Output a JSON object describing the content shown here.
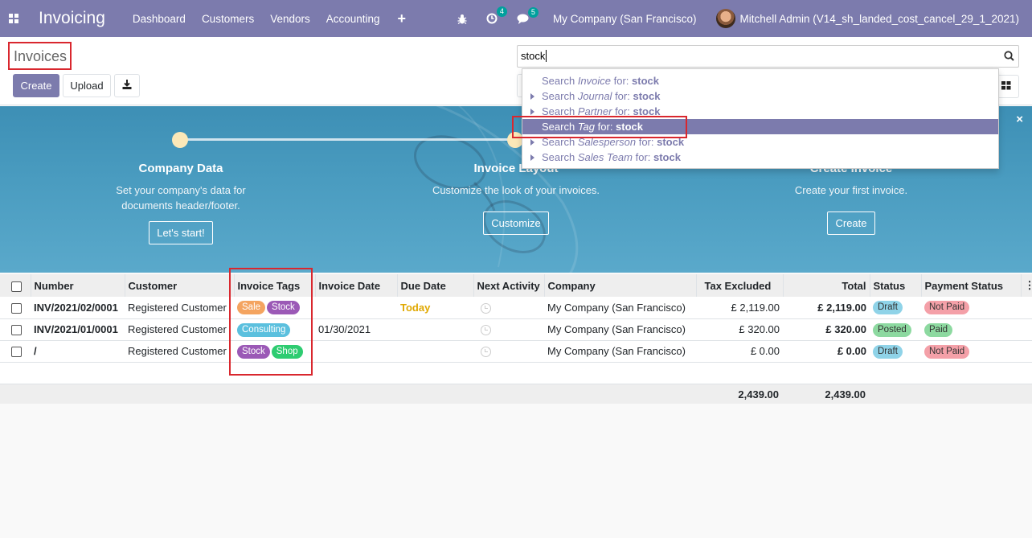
{
  "navbar": {
    "app_name": "Invoicing",
    "menu": [
      "Dashboard",
      "Customers",
      "Vendors",
      "Accounting"
    ],
    "plus": "+",
    "activity_count": "4",
    "message_count": "5",
    "company": "My Company (San Francisco)",
    "user": "Mitchell Admin (V14_sh_landed_cost_cancel_29_1_2021)"
  },
  "control_panel": {
    "title": "Invoices",
    "create_label": "Create",
    "upload_label": "Upload",
    "search_value": "stock"
  },
  "autocomplete": [
    {
      "pre": "Search ",
      "field": "Invoice",
      "mid": " for: ",
      "term": "stock",
      "expandable": false,
      "active": false
    },
    {
      "pre": "Search ",
      "field": "Journal",
      "mid": " for: ",
      "term": "stock",
      "expandable": true,
      "active": false
    },
    {
      "pre": "Search ",
      "field": "Partner",
      "mid": " for: ",
      "term": "stock",
      "expandable": true,
      "active": false
    },
    {
      "pre": "Search ",
      "field": "Tag",
      "mid": " for: ",
      "term": "stock",
      "expandable": false,
      "active": true
    },
    {
      "pre": "Search ",
      "field": "Salesperson",
      "mid": " for: ",
      "term": "stock",
      "expandable": true,
      "active": false
    },
    {
      "pre": "Search ",
      "field": "Sales Team",
      "mid": " for: ",
      "term": "stock",
      "expandable": true,
      "active": false
    }
  ],
  "banner": {
    "close": "×",
    "steps": [
      {
        "title": "Company Data",
        "desc1": "Set your company's data for",
        "desc2": "documents header/footer.",
        "button": "Let's start!"
      },
      {
        "title": "Invoice Layout",
        "desc1": "Customize the look of your invoices.",
        "desc2": "",
        "button": "Customize"
      },
      {
        "title": "Create Invoice",
        "desc1": "Create your first invoice.",
        "desc2": "",
        "button": "Create"
      }
    ]
  },
  "table": {
    "headers": [
      "Number",
      "Customer",
      "Invoice Tags",
      "Invoice Date",
      "Due Date",
      "Next Activity",
      "Company",
      "Tax Excluded",
      "Total",
      "Status",
      "Payment Status"
    ],
    "rows": [
      {
        "number": "INV/2021/02/0001",
        "customer": "Registered Customer",
        "tags": [
          {
            "label": "Sale",
            "color": "#f4a460"
          },
          {
            "label": "Stock",
            "color": "#9b59b6"
          }
        ],
        "invoice_date": "",
        "due_date": "Today",
        "company": "My Company (San Francisco)",
        "tax_excluded": "£ 2,119.00",
        "total": "£ 2,119.00",
        "status": "Draft",
        "status_color": "#8fd3e8",
        "payment": "Not Paid",
        "payment_color": "#f4a0a8"
      },
      {
        "number": "INV/2021/01/0001",
        "customer": "Registered Customer",
        "tags": [
          {
            "label": "Consulting",
            "color": "#5bc0de"
          }
        ],
        "invoice_date": "01/30/2021",
        "due_date": "",
        "company": "My Company (San Francisco)",
        "tax_excluded": "£ 320.00",
        "total": "£ 320.00",
        "status": "Posted",
        "status_color": "#8dd9a0",
        "payment": "Paid",
        "payment_color": "#8dd9a0"
      },
      {
        "number": "/",
        "customer": "Registered Customer",
        "tags": [
          {
            "label": "Stock",
            "color": "#9b59b6"
          },
          {
            "label": "Shop",
            "color": "#2ecc71"
          }
        ],
        "invoice_date": "",
        "due_date": "",
        "company": "My Company (San Francisco)",
        "tax_excluded": "£ 0.00",
        "total": "£ 0.00",
        "status": "Draft",
        "status_color": "#8fd3e8",
        "payment": "Not Paid",
        "payment_color": "#f4a0a8"
      }
    ],
    "sum_tax_excluded": "2,439.00",
    "sum_total": "2,439.00"
  }
}
